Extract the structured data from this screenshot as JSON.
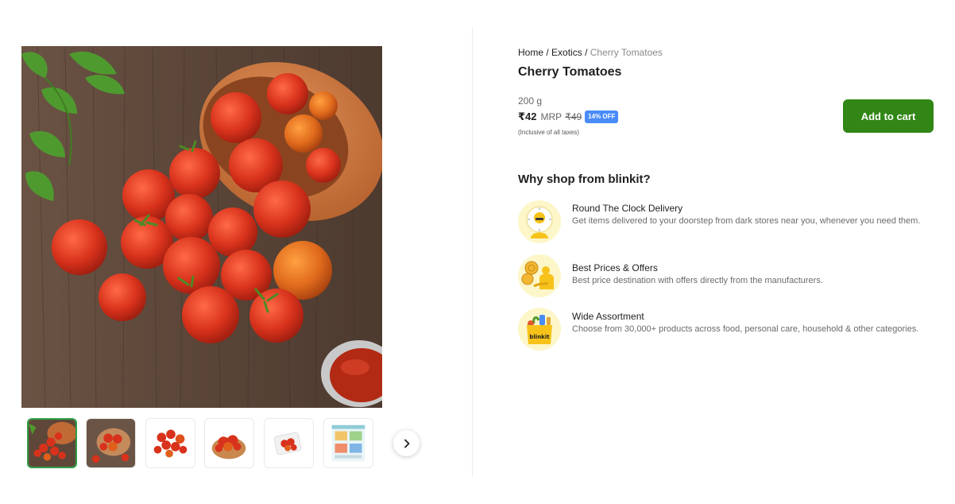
{
  "product": {
    "image_alt": "cherry tomatoes spilling from terracotta pot",
    "thumbnail_count": 6
  },
  "breadcrumb": {
    "items": [
      "Home",
      "Exotics"
    ],
    "separator": "/",
    "current": "Cherry Tomatoes"
  },
  "title": "Cherry Tomatoes",
  "pricing": {
    "weight": "200 g",
    "price": "₹42",
    "mrp_label": "MRP",
    "mrp": "₹49",
    "discount_badge": "14% OFF",
    "tax_note": "(Inclusive of all taxes)"
  },
  "cart": {
    "add_label": "Add to cart"
  },
  "why": {
    "title": "Why shop from blinkit?",
    "features": [
      {
        "title": "Round The Clock Delivery",
        "desc": "Get items delivered to your doorstep from dark stores near you, whenever you need them.",
        "icon": "delivery-clock-icon"
      },
      {
        "title": "Best Prices & Offers",
        "desc": "Best price destination with offers directly from the manufacturers.",
        "icon": "best-prices-icon"
      },
      {
        "title": "Wide Assortment",
        "desc": "Choose from 30,000+ products across food, personal care, household & other categories.",
        "icon": "grocery-bag-icon",
        "bag_label": "blinkit"
      }
    ]
  },
  "colors": {
    "accent_green": "#318616",
    "badge_blue": "#4a8cf7",
    "thumb_active_border": "#2f9e44"
  }
}
